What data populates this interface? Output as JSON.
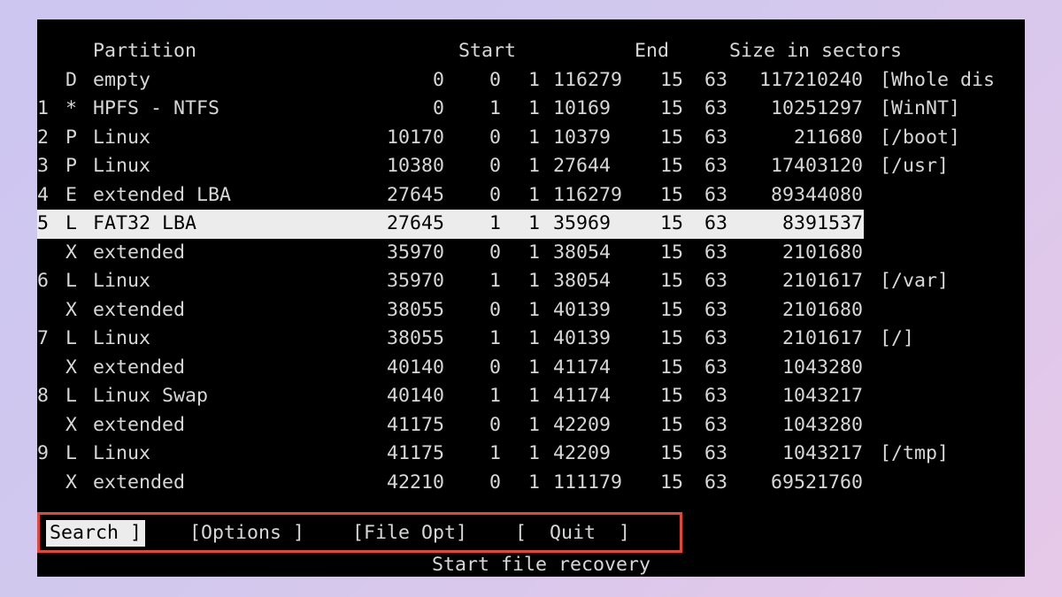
{
  "header": {
    "partition": "Partition",
    "start": "Start",
    "end": "End",
    "size": "Size in sectors"
  },
  "rows": [
    {
      "num": "",
      "type": "D",
      "name": "empty",
      "s1": "0",
      "s2": "0",
      "s3": "1",
      "e1": "116279",
      "e2": "15",
      "e3": "63",
      "size": "117210240",
      "label": "[Whole dis"
    },
    {
      "num": "1",
      "type": "*",
      "name": "HPFS - NTFS",
      "s1": "0",
      "s2": "1",
      "s3": "1",
      "e1": "10169",
      "e2": "15",
      "e3": "63",
      "size": "10251297",
      "label": "[WinNT]"
    },
    {
      "num": "2",
      "type": "P",
      "name": "Linux",
      "s1": "10170",
      "s2": "0",
      "s3": "1",
      "e1": "10379",
      "e2": "15",
      "e3": "63",
      "size": "211680",
      "label": "[/boot]"
    },
    {
      "num": "3",
      "type": "P",
      "name": "Linux",
      "s1": "10380",
      "s2": "0",
      "s3": "1",
      "e1": "27644",
      "e2": "15",
      "e3": "63",
      "size": "17403120",
      "label": "[/usr]"
    },
    {
      "num": "4",
      "type": "E",
      "name": "extended LBA",
      "s1": "27645",
      "s2": "0",
      "s3": "1",
      "e1": "116279",
      "e2": "15",
      "e3": "63",
      "size": "89344080",
      "label": ""
    },
    {
      "num": "5",
      "type": "L",
      "name": "FAT32 LBA",
      "s1": "27645",
      "s2": "1",
      "s3": "1",
      "e1": "35969",
      "e2": "15",
      "e3": "63",
      "size": "8391537",
      "label": "",
      "selected": true
    },
    {
      "num": "",
      "type": "X",
      "name": "extended",
      "s1": "35970",
      "s2": "0",
      "s3": "1",
      "e1": "38054",
      "e2": "15",
      "e3": "63",
      "size": "2101680",
      "label": ""
    },
    {
      "num": "6",
      "type": "L",
      "name": "Linux",
      "s1": "35970",
      "s2": "1",
      "s3": "1",
      "e1": "38054",
      "e2": "15",
      "e3": "63",
      "size": "2101617",
      "label": "[/var]"
    },
    {
      "num": "",
      "type": "X",
      "name": "extended",
      "s1": "38055",
      "s2": "0",
      "s3": "1",
      "e1": "40139",
      "e2": "15",
      "e3": "63",
      "size": "2101680",
      "label": ""
    },
    {
      "num": "7",
      "type": "L",
      "name": "Linux",
      "s1": "38055",
      "s2": "1",
      "s3": "1",
      "e1": "40139",
      "e2": "15",
      "e3": "63",
      "size": "2101617",
      "label": "[/]"
    },
    {
      "num": "",
      "type": "X",
      "name": "extended",
      "s1": "40140",
      "s2": "0",
      "s3": "1",
      "e1": "41174",
      "e2": "15",
      "e3": "63",
      "size": "1043280",
      "label": ""
    },
    {
      "num": "8",
      "type": "L",
      "name": "Linux Swap",
      "s1": "40140",
      "s2": "1",
      "s3": "1",
      "e1": "41174",
      "e2": "15",
      "e3": "63",
      "size": "1043217",
      "label": ""
    },
    {
      "num": "",
      "type": "X",
      "name": "extended",
      "s1": "41175",
      "s2": "0",
      "s3": "1",
      "e1": "42209",
      "e2": "15",
      "e3": "63",
      "size": "1043280",
      "label": ""
    },
    {
      "num": "9",
      "type": "L",
      "name": "Linux",
      "s1": "41175",
      "s2": "1",
      "s3": "1",
      "e1": "42209",
      "e2": "15",
      "e3": "63",
      "size": "1043217",
      "label": "[/tmp]"
    },
    {
      "num": "",
      "type": "X",
      "name": "extended",
      "s1": "42210",
      "s2": "0",
      "s3": "1",
      "e1": "111179",
      "e2": "15",
      "e3": "63",
      "size": "69521760",
      "label": ""
    }
  ],
  "menu": {
    "search": "Search ]",
    "options": "[Options ]",
    "file_opt": "[File Opt]",
    "quit": "[  Quit  ]"
  },
  "status": "Start file recovery",
  "colors": {
    "terminal_bg": "#000000",
    "text": "#d7d7d7",
    "highlight_bg": "#ececec",
    "highlight_text": "#000000",
    "menu_border": "#e1483b"
  }
}
